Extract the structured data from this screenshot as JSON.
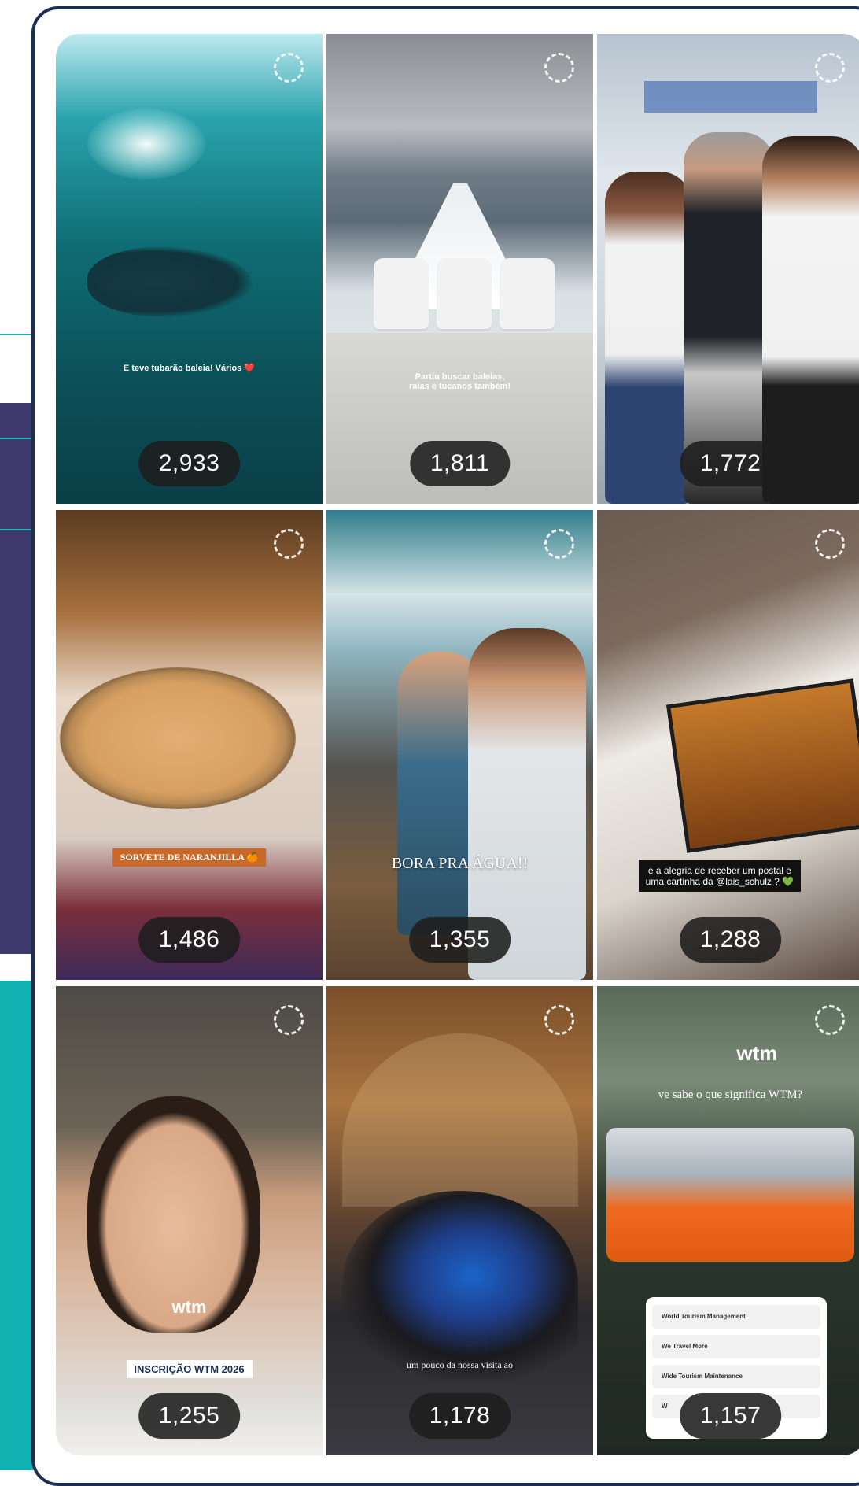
{
  "tiles": [
    {
      "count": "2,933",
      "caption": "E teve tubarão baleia! Vários ❤️"
    },
    {
      "count": "1,811",
      "caption": "Partiu buscar baleias, raias e tucanos também!"
    },
    {
      "count": "1,772",
      "caption": ""
    },
    {
      "count": "1,486",
      "caption": "SORVETE DE NARANJILLA 🍊"
    },
    {
      "count": "1,355",
      "caption": "BORA PRA ÁGUA!!"
    },
    {
      "count": "1,288",
      "caption": "e a alegria de receber um postal e uma cartinha da @lais_schulz ? 💚"
    },
    {
      "count": "1,255",
      "caption": "INSCRIÇÃO WTM 2026",
      "logo": "wtm"
    },
    {
      "count": "1,178",
      "caption": "um pouco da nossa visita ao"
    },
    {
      "count": "1,157",
      "logo": "wtm",
      "caption": "ve sabe o que significa WTM?",
      "poll": [
        "World Tourism Management",
        "We Travel More",
        "Wide Tourism Maintenance",
        "W"
      ]
    }
  ],
  "icons": {
    "status": "loading-spinner-icon"
  },
  "colors": {
    "frame": "#1c2f52",
    "purple_band": "#3f3a6e",
    "teal_band": "#0fb1b1",
    "count_badge": "#1e1e1e"
  }
}
